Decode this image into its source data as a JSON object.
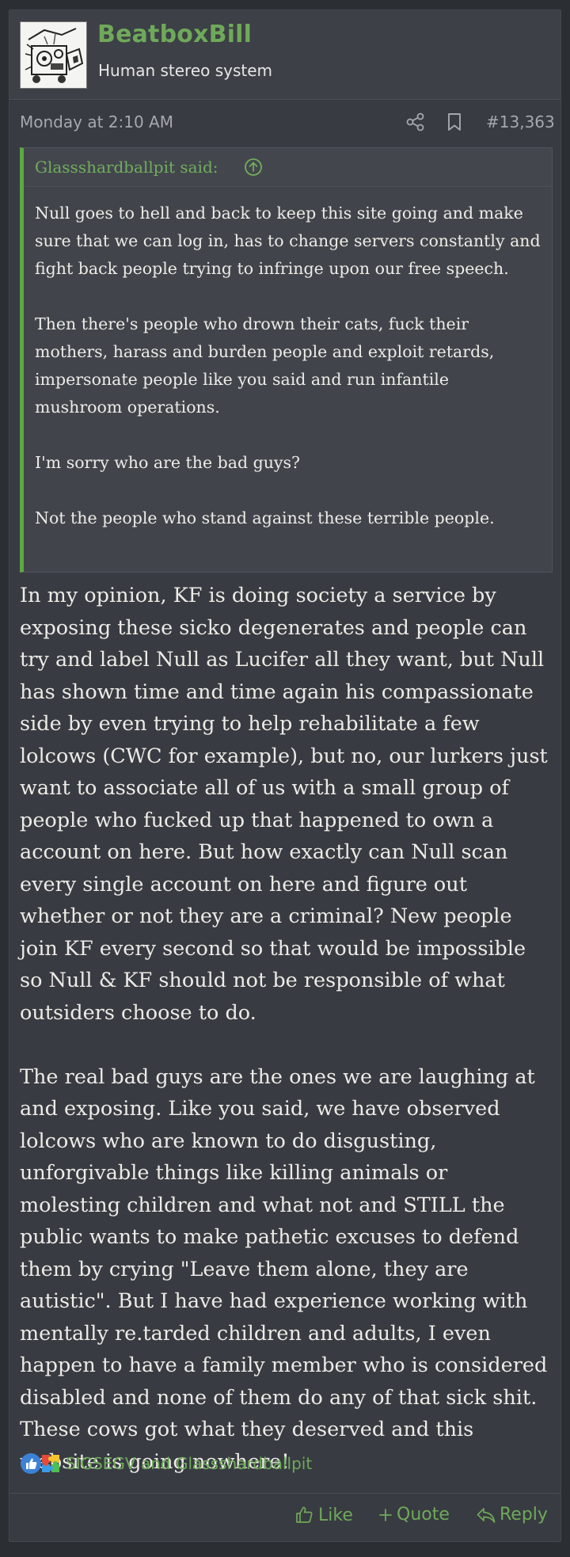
{
  "user": {
    "name": "BeatboxBill",
    "title": "Human stereo system"
  },
  "post": {
    "date": "Monday at 2:10 AM",
    "number": "#13,363"
  },
  "quote": {
    "author": "Glassshardballpit said:",
    "paragraphs": [
      "Null goes to hell and back to keep this site going and make sure that we can log in, has to change servers constantly and fight back people trying to infringe upon our free speech.",
      "Then there's people who drown their cats, fuck their mothers, harass and burden people and exploit retards, impersonate people like you said and run infantile mushroom operations.",
      "I'm sorry who are the bad guys?",
      "Not the people who stand against these terrible people."
    ]
  },
  "message": {
    "paragraphs": [
      "In my opinion, KF is doing society a service by exposing these sicko degenerates and people can try and label Null as Lucifer all they want, but Null has shown time and time again his compassionate side by even trying to help rehabilitate a few lolcows (CWC for example), but no, our lurkers just want to associate all of us with a small group of people who fucked up that happened to own a account on here. But how exactly can Null scan every single account on here and figure out whether or not they are a criminal? New people join KF every second so that would be impossible so Null & KF should not be responsible of what outsiders choose to do.",
      "The real bad guys are the ones we are laughing at and exposing. Like you said, we have observed lolcows who are known to do disgusting, unforgivable things like killing animals or molesting children and what not and STILL the public wants to make pathetic excuses to defend them by crying \"Leave them alone, they are autistic\". But I have had experience working with mentally re.tarded children and adults, I even happen to have a family member who is considered disabled and none of them do any of that sick shit. These cows got what they deserved and this website is going nowhere!"
    ]
  },
  "reactions": {
    "text": "SIGSEGV and Glassshardballpit",
    "icons": [
      "like-reaction-icon",
      "autistic-puzzle-reaction-icon"
    ]
  },
  "actions": {
    "like": "Like",
    "quote": "Quote",
    "reply": "Reply"
  },
  "colors": {
    "accent": "#6fa95a",
    "background": "#2b2e33",
    "post_bg": "#383b41",
    "text": "#ecebe6",
    "muted": "#a5a8ad"
  }
}
